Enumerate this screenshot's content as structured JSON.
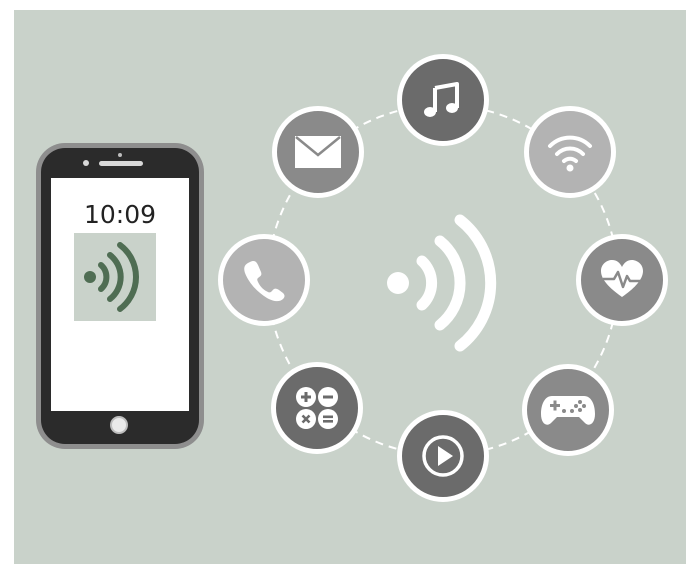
{
  "phone": {
    "time": "10:09"
  },
  "colors": {
    "background": "#c9d2ca",
    "nfc_green": "#4f6d53",
    "dark_circle": "#6b6b6b",
    "mid_circle": "#8a8a8a",
    "light_circle": "#b3b3b3",
    "ring_white": "#ffffff"
  },
  "icons": [
    "music-icon",
    "wifi-icon",
    "heart-rate-icon",
    "gamepad-icon",
    "play-icon",
    "calculator-icon",
    "phone-call-icon",
    "mail-icon",
    "nfc-icon"
  ]
}
